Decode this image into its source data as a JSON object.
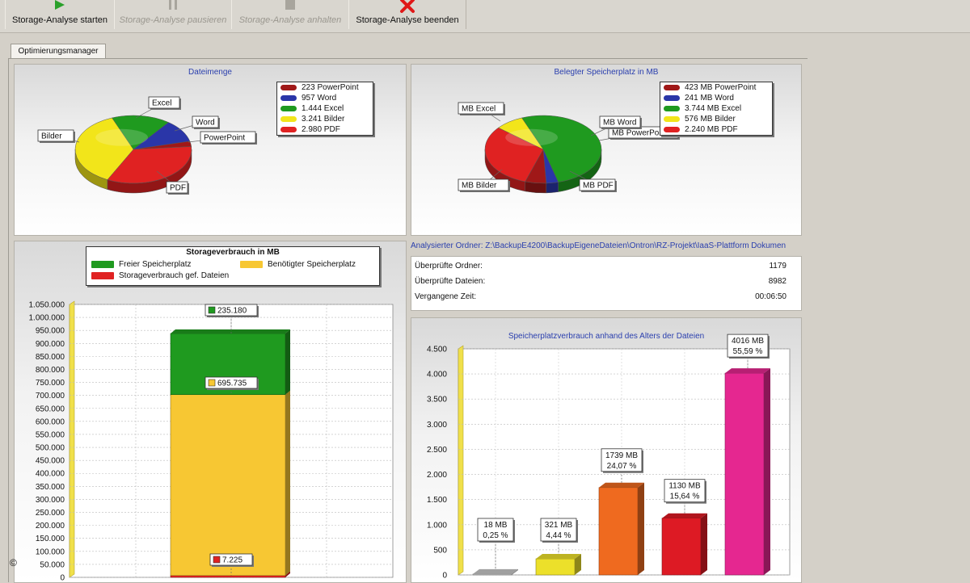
{
  "toolbar": {
    "start": "Storage-Analyse starten",
    "pause": "Storage-Analyse pausieren",
    "stop": "Storage-Analyse anhalten",
    "quit": "Storage-Analyse beenden"
  },
  "tab_label": "Optimierungsmanager",
  "colors": {
    "powerpoint": "#a01818",
    "word": "#2a36a8",
    "excel": "#1f9a1f",
    "bilder": "#f2e51a",
    "pdf": "#e02222"
  },
  "analysis": {
    "folder_path": "Analysierter Ordner: Z:\\BackupE4200\\BackupEigeneDateien\\Ontron\\RZ-Projekt\\IaaS-Plattform Dokumen",
    "rows": [
      {
        "label": "Überprüfte Ordner:",
        "value": "1179"
      },
      {
        "label": "Überprüfte Dateien:",
        "value": "8982"
      },
      {
        "label": "Vergangene Zeit:",
        "value": "00:06:50"
      }
    ]
  },
  "copyright": "©",
  "chart_data": [
    {
      "type": "pie",
      "title": "Dateimenge",
      "slices": [
        {
          "name": "PowerPoint",
          "value": 223,
          "legend": "223 PowerPoint",
          "label": "PowerPoint",
          "color": "#a01818"
        },
        {
          "name": "Word",
          "value": 957,
          "legend": "957 Word",
          "label": "Word",
          "color": "#2a36a8"
        },
        {
          "name": "Excel",
          "value": 1444,
          "legend": "1.444 Excel",
          "label": "Excel",
          "color": "#1f9a1f"
        },
        {
          "name": "Bilder",
          "value": 3241,
          "legend": "3.241 Bilder",
          "label": "Bilder",
          "color": "#f2e51a"
        },
        {
          "name": "PDF",
          "value": 2980,
          "legend": "2.980 PDF",
          "label": "PDF",
          "color": "#e02222"
        }
      ]
    },
    {
      "type": "pie",
      "title": "Belegter Speicherplatz in MB",
      "slices": [
        {
          "name": "MB PowerPoint",
          "value": 423,
          "legend": "423 MB PowerPoint",
          "label": "MB PowerPoint",
          "color": "#a01818"
        },
        {
          "name": "MB Word",
          "value": 241,
          "legend": "241 MB Word",
          "label": "MB Word",
          "color": "#2a36a8"
        },
        {
          "name": "MB Excel",
          "value": 3744,
          "legend": "3.744 MB Excel",
          "label": "MB Excel",
          "color": "#1f9a1f"
        },
        {
          "name": "MB Bilder",
          "value": 576,
          "legend": "576 MB Bilder",
          "label": "MB Bilder",
          "color": "#f2e51a"
        },
        {
          "name": "MB PDF",
          "value": 2240,
          "legend": "2.240 MB PDF",
          "label": "MB PDF",
          "color": "#e02222"
        }
      ]
    },
    {
      "type": "bar",
      "title": "Storageverbrauch in MB",
      "stacked": true,
      "ylim": [
        0,
        1050000
      ],
      "yticks": [
        "0",
        "50.000",
        "100.000",
        "150.000",
        "200.000",
        "250.000",
        "300.000",
        "350.000",
        "400.000",
        "450.000",
        "500.000",
        "550.000",
        "600.000",
        "650.000",
        "700.000",
        "750.000",
        "800.000",
        "850.000",
        "900.000",
        "950.000",
        "1.000.000",
        "1.050.000"
      ],
      "legend_placement": "top",
      "series": [
        {
          "name": "Storageverbrauch gef. Dateien",
          "value": 7225,
          "label": "7.225",
          "color": "#e02222"
        },
        {
          "name": "Benötigter Speicherplatz",
          "value": 695735,
          "label": "695.735",
          "color": "#f7c733"
        },
        {
          "name": "Freier Speicherplatz",
          "value": 235180,
          "label": "235.180",
          "color": "#1f9a1f"
        }
      ]
    },
    {
      "type": "bar",
      "title": "Speicherplatzverbrauch anhand des Alters der Dateien",
      "ylim": [
        0,
        4500
      ],
      "yticks": [
        "0",
        "500",
        "1.000",
        "1.500",
        "2.000",
        "2.500",
        "3.000",
        "3.500",
        "4.000",
        "4.500"
      ],
      "bars": [
        {
          "value": 18,
          "label1": "18 MB",
          "label2": "0,25 %",
          "color": "#c8c8c8"
        },
        {
          "value": 321,
          "label1": "321 MB",
          "label2": "4,44 %",
          "color": "#ece02a"
        },
        {
          "value": 1739,
          "label1": "1739 MB",
          "label2": "24,07 %",
          "color": "#ef6a1f"
        },
        {
          "value": 1130,
          "label1": "1130 MB",
          "label2": "15,64 %",
          "color": "#dd1a24"
        },
        {
          "value": 4016,
          "label1": "4016 MB",
          "label2": "55,59 %",
          "color": "#e52790"
        }
      ]
    }
  ]
}
